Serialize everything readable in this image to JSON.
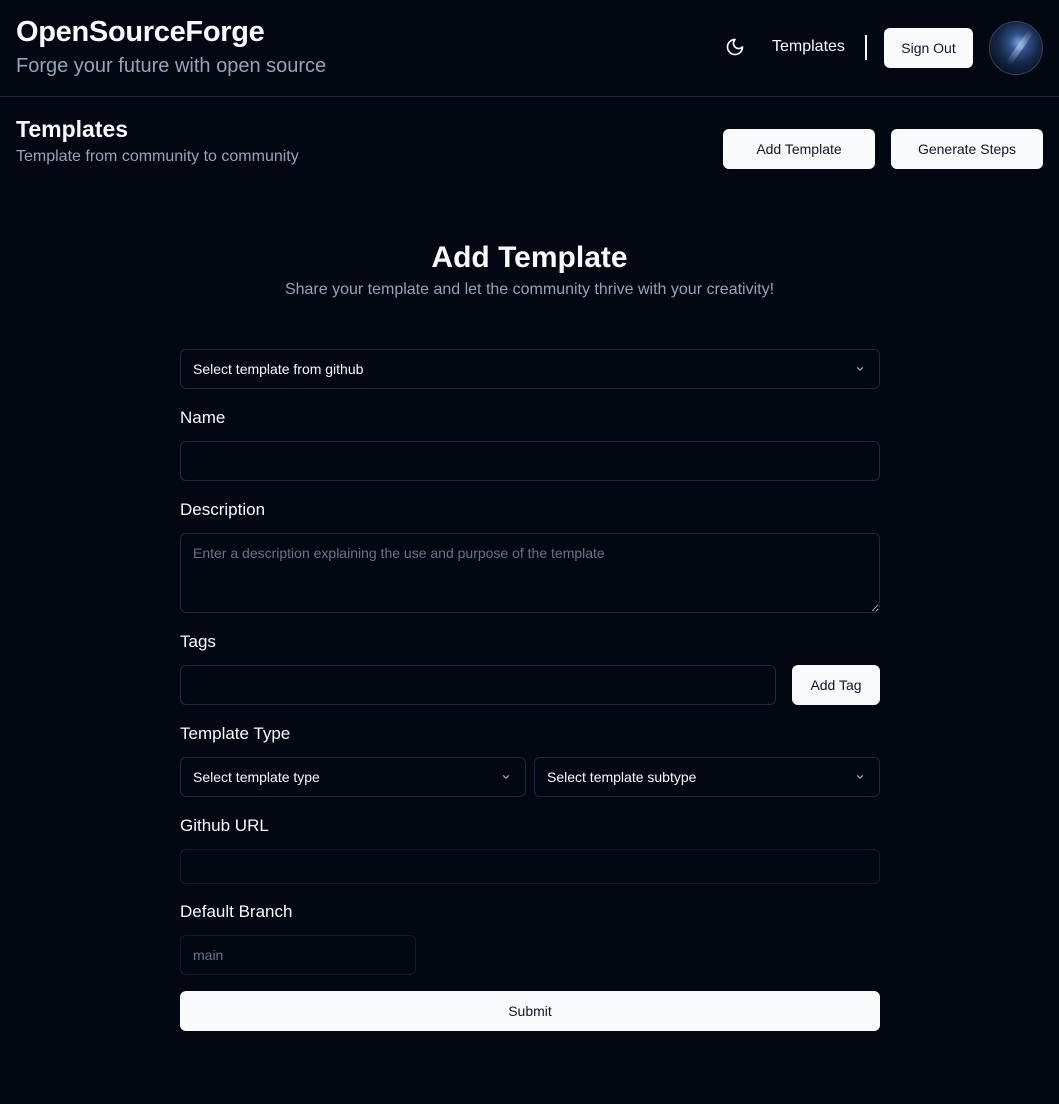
{
  "header": {
    "brand_title": "OpenSourceForge",
    "brand_subtitle": "Forge your future with open source",
    "theme_icon": "moon-icon",
    "nav_templates": "Templates",
    "sign_out": "Sign Out",
    "avatar_icon": "avatar"
  },
  "page": {
    "title": "Templates",
    "subtitle": "Template from community to community",
    "add_template_button": "Add Template",
    "generate_steps_button": "Generate Steps"
  },
  "form": {
    "title": "Add Template",
    "subtitle": "Share your template and let the community thrive with your creativity!",
    "github_select": "Select template from github",
    "name_label": "Name",
    "name_value": "",
    "description_label": "Description",
    "description_placeholder": "Enter a description explaining the use and purpose of the template",
    "tags_label": "Tags",
    "tags_value": "",
    "add_tag_button": "Add Tag",
    "template_type_label": "Template Type",
    "type_select": "Select template type",
    "subtype_select": "Select template subtype",
    "github_url_label": "Github URL",
    "github_url_value": "",
    "default_branch_label": "Default Branch",
    "default_branch_placeholder": "main",
    "submit_button": "Submit"
  },
  "colors": {
    "background": "#030712",
    "border": "#1e293b",
    "button_bg": "#f8fafc",
    "button_text": "#0f172a",
    "muted_text": "#94a3b8"
  }
}
